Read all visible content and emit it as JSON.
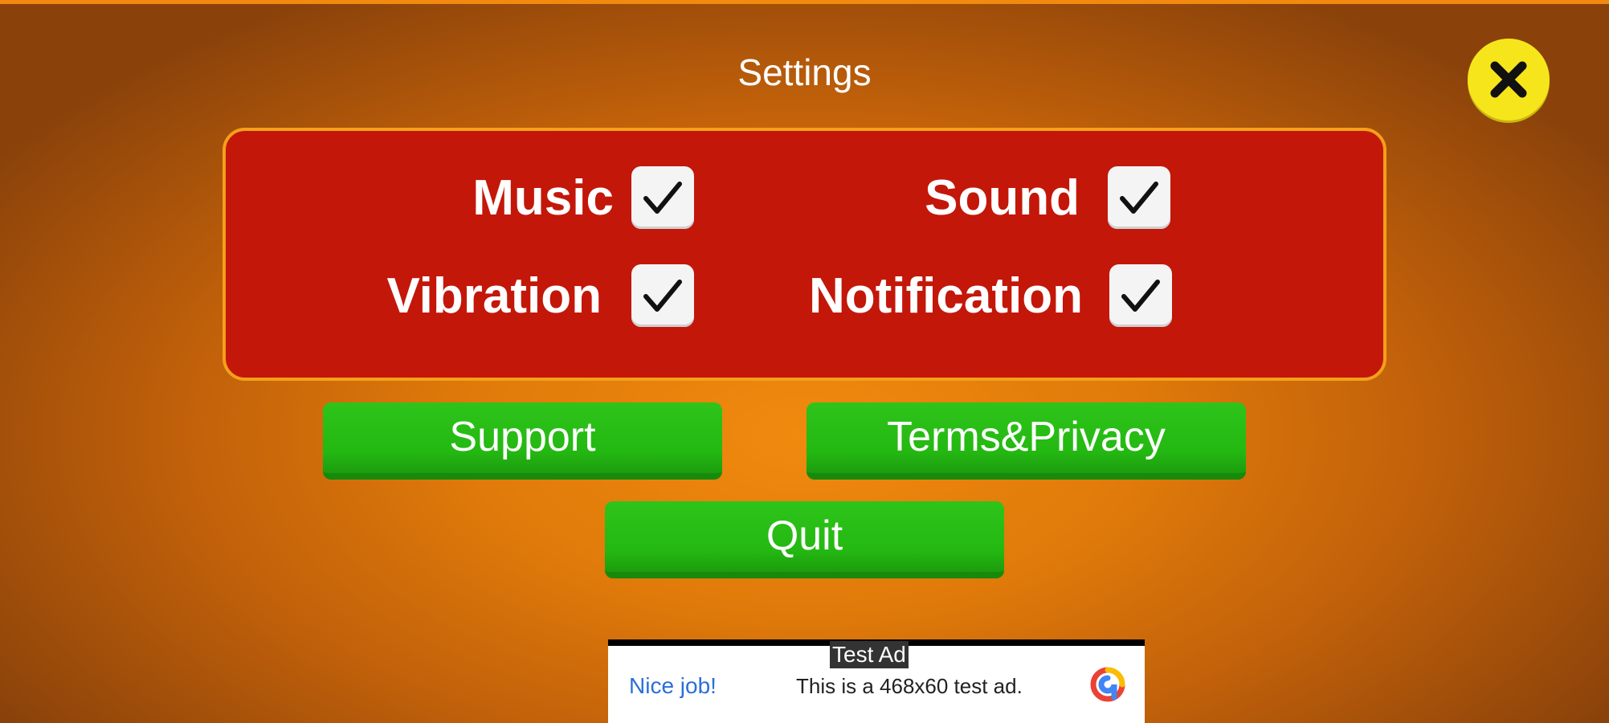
{
  "title": "Settings",
  "close": {
    "icon": "close-icon"
  },
  "options": [
    {
      "label": "Music",
      "checked": true
    },
    {
      "label": "Sound",
      "checked": true
    },
    {
      "label": "Vibration",
      "checked": true
    },
    {
      "label": "Notification",
      "checked": true
    }
  ],
  "buttons": {
    "support": "Support",
    "terms": "Terms&Privacy",
    "quit": "Quit"
  },
  "ad": {
    "label": "Test Ad",
    "nice": "Nice job!",
    "text": "This is a 468x60 test ad.",
    "logo_icon": "admob-logo-icon"
  },
  "colors": {
    "background": "#e07a0a",
    "panel": "#c3170a",
    "panel_border": "#f4a01a",
    "button_green": "#24b812",
    "close_yellow": "#f7e51b"
  }
}
